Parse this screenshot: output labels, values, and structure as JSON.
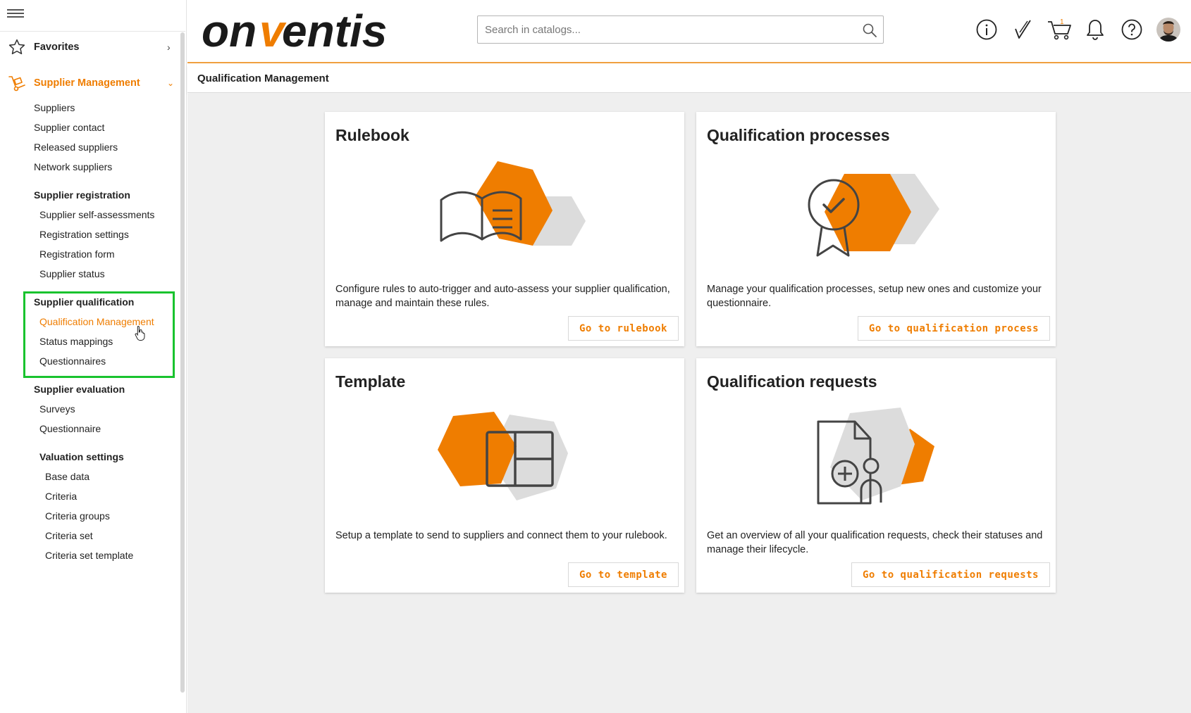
{
  "brand": {
    "logo_text_start": "on",
    "logo_text_v": "v",
    "logo_text_end": "entis",
    "accent": "#ef7d00",
    "highlight": "#19c32e"
  },
  "sidebar": {
    "favorites": {
      "label": "Favorites",
      "icon": "star-icon"
    },
    "supplier_management": {
      "label": "Supplier Management",
      "icon": "hand-truck-icon"
    },
    "items": [
      "Suppliers",
      "Supplier contact",
      "Released suppliers",
      "Network suppliers"
    ],
    "registration": {
      "heading": "Supplier registration",
      "items": [
        "Supplier self-assessments",
        "Registration settings",
        "Registration form",
        "Supplier status"
      ]
    },
    "qualification": {
      "heading": "Supplier qualification",
      "items": [
        "Qualification Management",
        "Status mappings",
        "Questionnaires"
      ]
    },
    "evaluation": {
      "heading": "Supplier evaluation",
      "items": [
        "Surveys",
        "Questionnaire"
      ]
    },
    "valuation": {
      "heading": "Valuation settings",
      "items": [
        "Base data",
        "Criteria",
        "Criteria groups",
        "Criteria set",
        "Criteria set template"
      ]
    }
  },
  "header": {
    "search_placeholder": "Search in catalogs...",
    "cart_count": "1",
    "icons": [
      "info-icon",
      "approval-check-icon",
      "cart-icon",
      "bell-icon",
      "help-icon",
      "user-avatar"
    ]
  },
  "page": {
    "title": "Qualification Management"
  },
  "cards": [
    {
      "title": "Rulebook",
      "description": "Configure rules to auto-trigger and auto-assess your supplier qualification, manage and maintain these rules.",
      "button": "Go to rulebook",
      "icon": "rulebook-book-icon"
    },
    {
      "title": "Qualification processes",
      "description": "Manage your qualification processes, setup new ones and customize your questionnaire.",
      "button": "Go to qualification process",
      "icon": "award-badge-icon"
    },
    {
      "title": "Template",
      "description": "Setup a template to send to suppliers and connect them to your rulebook.",
      "button": "Go to template",
      "icon": "template-layout-icon"
    },
    {
      "title": "Qualification requests",
      "description": "Get an overview of all your qualification requests, check their statuses and manage their lifecycle.",
      "button": "Go to qualification requests",
      "icon": "request-document-icon"
    }
  ]
}
